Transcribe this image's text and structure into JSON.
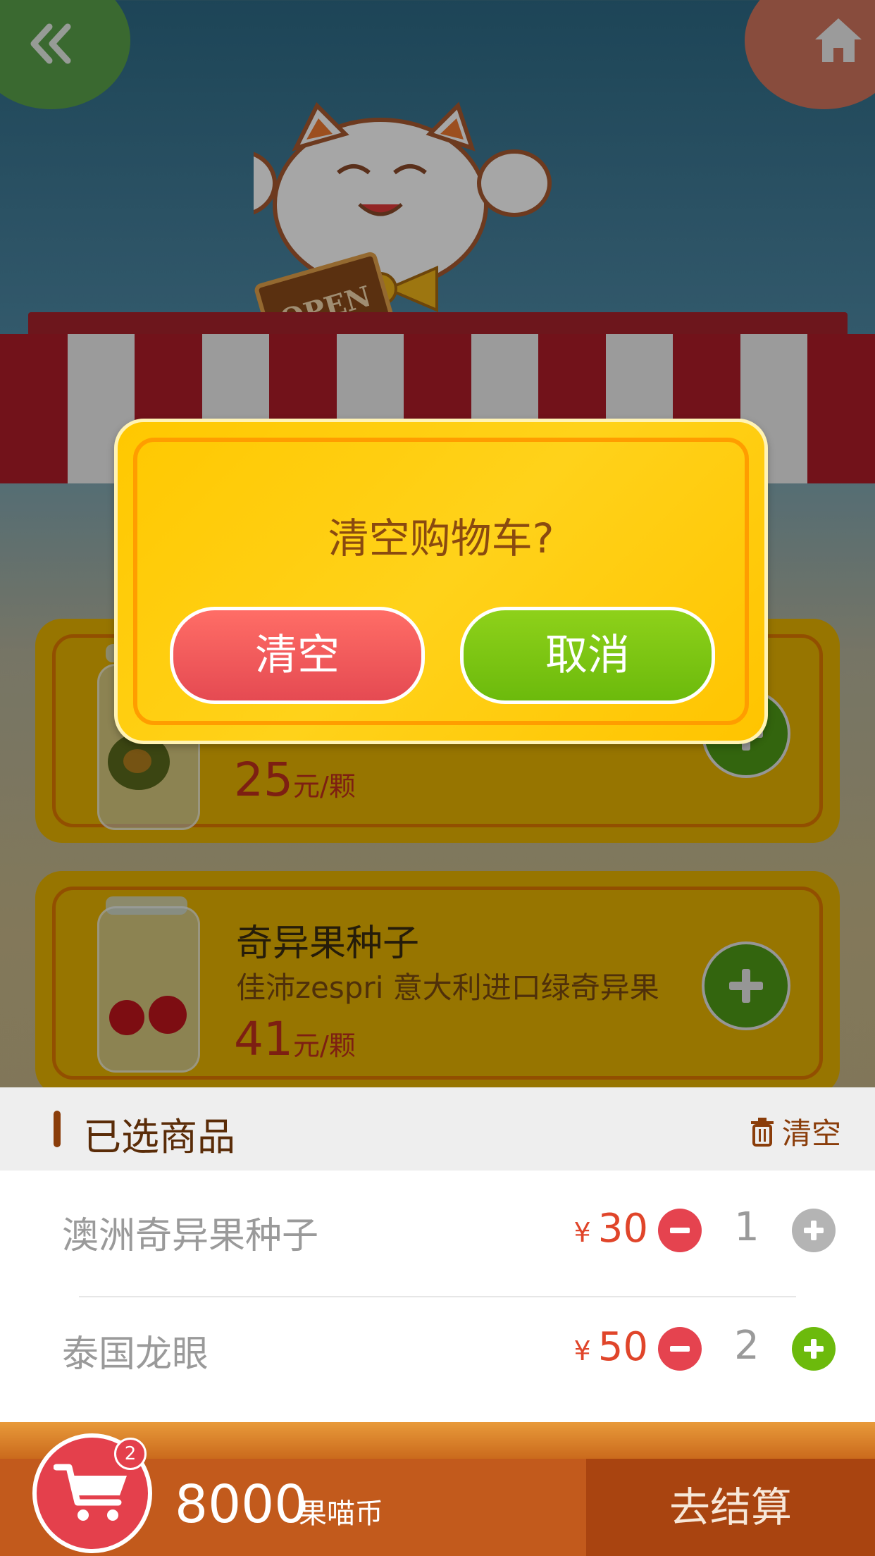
{
  "topbar": {
    "back_icon": "double-chevron-left-icon",
    "home_icon": "home-icon"
  },
  "mascot": {
    "sign_text": "OPEN"
  },
  "products": [
    {
      "name": "",
      "subtitle": "",
      "price": "25",
      "unit": "元/颗",
      "image": "avocado-jar"
    },
    {
      "name": "奇异果种子",
      "subtitle": "佳沛zespri 意大利进口绿奇异果",
      "price": "41",
      "unit": "元/颗",
      "image": "cherry-jar"
    }
  ],
  "dialog": {
    "title": "清空购物车?",
    "confirm_label": "清空",
    "cancel_label": "取消"
  },
  "selected": {
    "title": "已选商品",
    "clear_label": "清空",
    "items": [
      {
        "name": "澳洲奇异果种子",
        "currency": "¥",
        "price": "30",
        "qty": "1",
        "plus_state": "disabled"
      },
      {
        "name": "泰国龙眼",
        "currency": "¥",
        "price": "50",
        "qty": "2",
        "plus_state": "enabled"
      }
    ]
  },
  "bottom": {
    "cart_count": "2",
    "coins": "8000",
    "coins_unit": "果喵币",
    "checkout_label": "去结算"
  },
  "colors": {
    "accent_red": "#e4404c",
    "accent_green": "#6cba0c",
    "dialog_yellow": "#ffc800",
    "brown": "#8a3d0a"
  }
}
